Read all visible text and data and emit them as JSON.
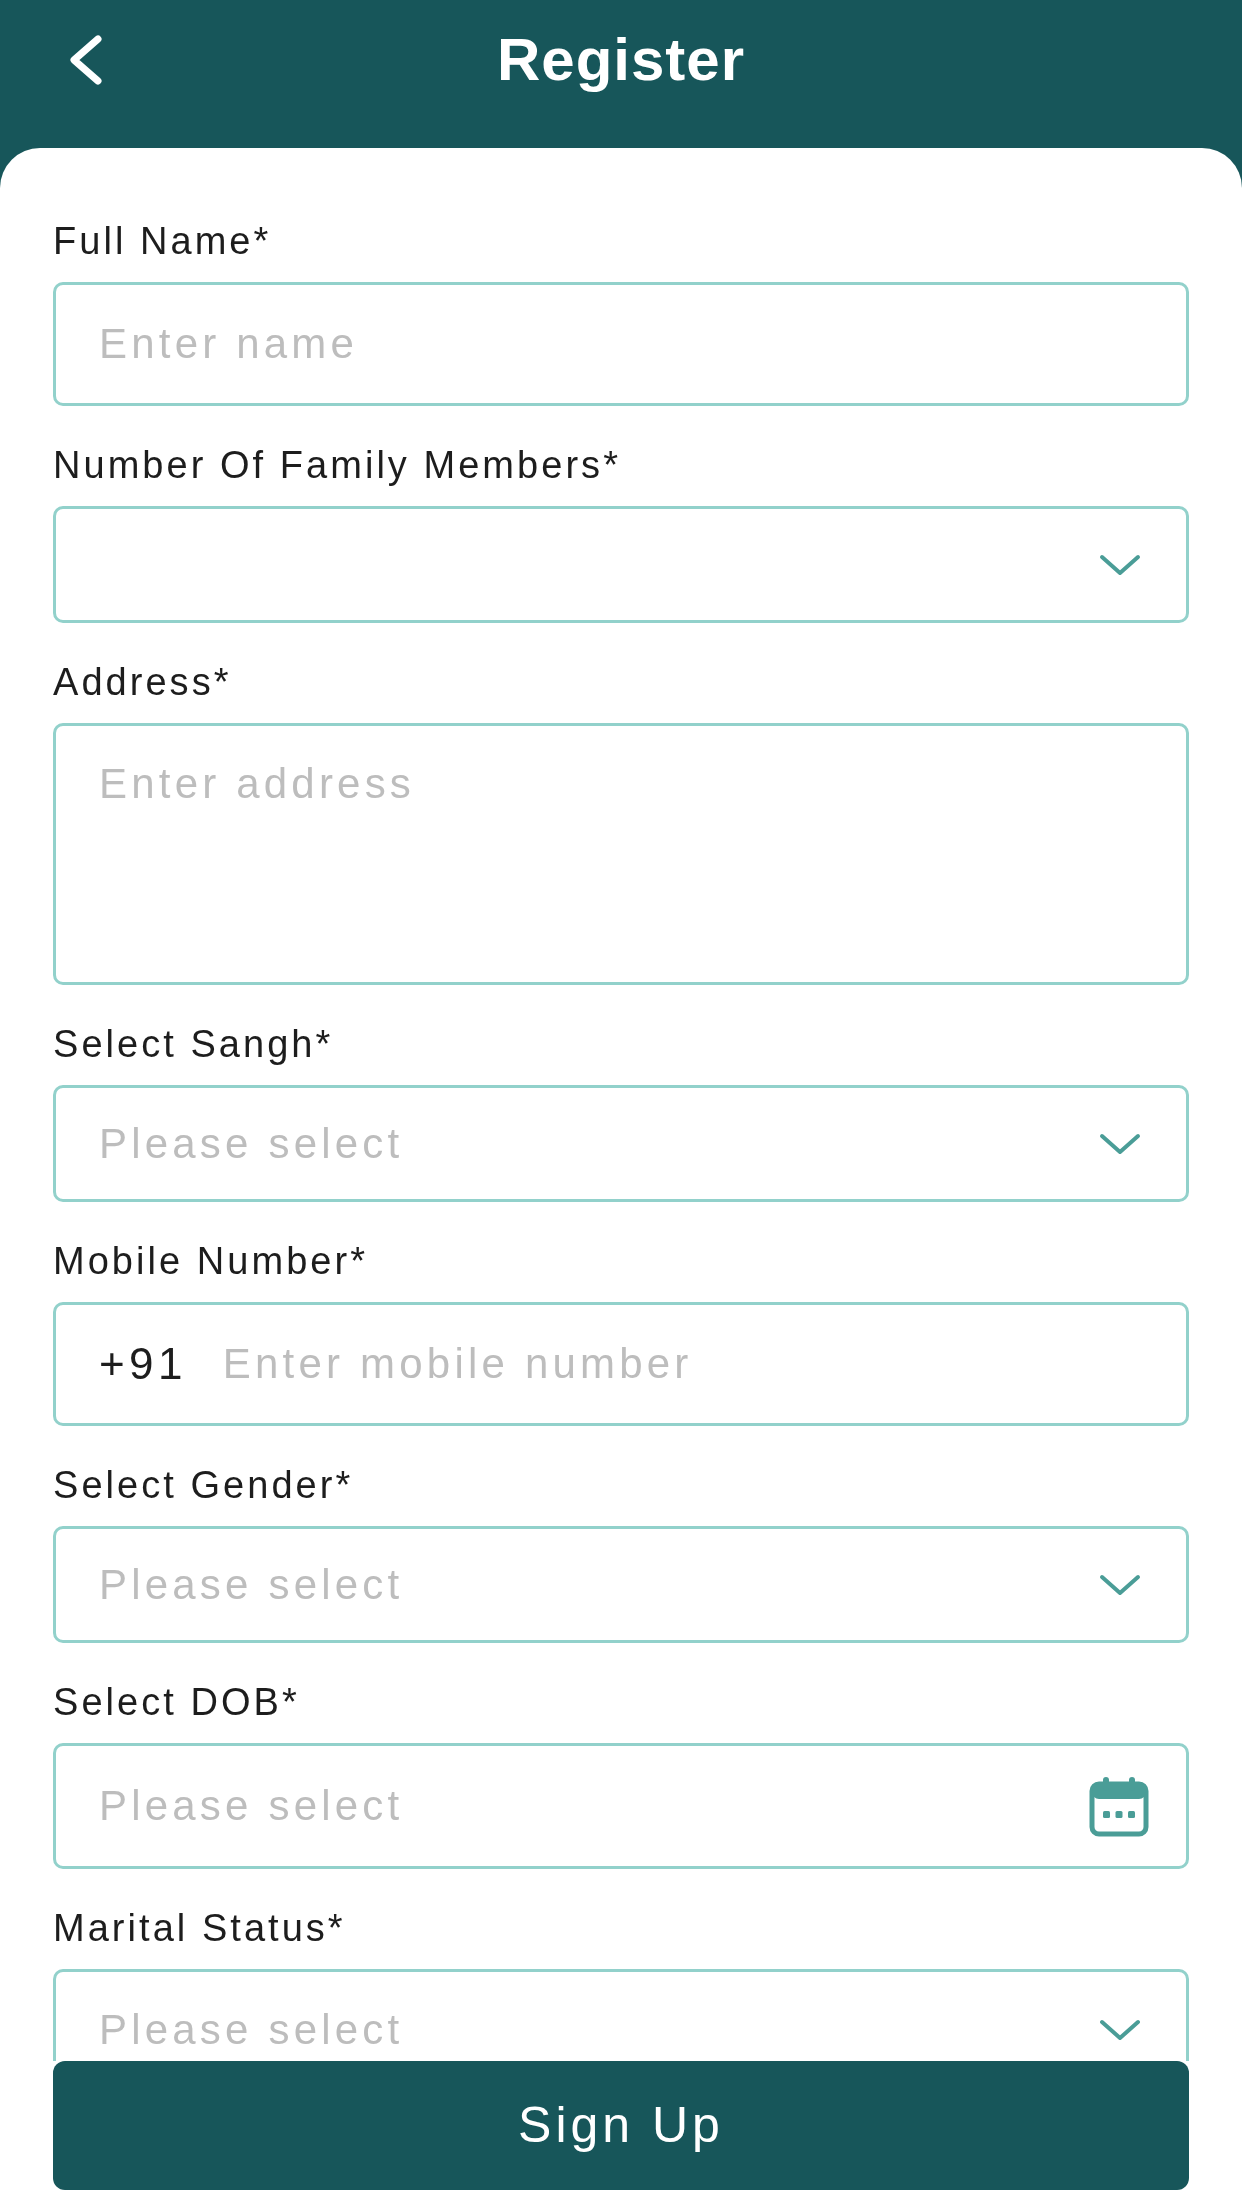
{
  "header": {
    "title": "Register"
  },
  "fields": [
    {
      "kind": "text",
      "label": "Full Name*",
      "placeholder": "Enter name"
    },
    {
      "kind": "select",
      "label": "Number Of Family Members*"
    },
    {
      "kind": "textarea",
      "label": "Address*",
      "placeholder": "Enter address"
    },
    {
      "kind": "select",
      "label": "Select Sangh*",
      "placeholder": "Please select"
    },
    {
      "kind": "phone",
      "label": "Mobile Number*",
      "prefix": "+91",
      "placeholder": "Enter mobile number"
    },
    {
      "kind": "select",
      "label": "Select Gender*",
      "placeholder": "Please select"
    },
    {
      "kind": "date",
      "label": "Select DOB*",
      "placeholder": "Please select"
    },
    {
      "kind": "select",
      "label": "Marital Status*",
      "placeholder": "Please select"
    }
  ],
  "submit_button": {
    "label": "Sign Up"
  }
}
